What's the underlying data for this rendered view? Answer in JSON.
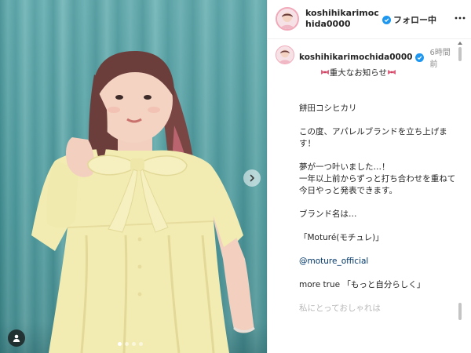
{
  "header": {
    "username": "koshihikarimochida0000",
    "follow_label": "フォロー中",
    "more_icon": "more-horizontal-icon"
  },
  "post": {
    "username": "koshihikarimochida0000",
    "time": "6時間前",
    "caption": {
      "headline": "重大なお知らせ",
      "name": "餅田コシヒカリ",
      "line1": "この度、アパレルブランドを立ち上げます！",
      "line2": "夢が一つ叶いました…！\n一年以上前からずっと打ち合わせを重ねて\n今日やっと発表できます。",
      "line3": "ブランド名は…",
      "line4": "「Moturé(モチュレ)」",
      "mention": "@moture_official",
      "line5": "more true 「もっと自分らしく」",
      "line6": "私にとっておしゃれは"
    }
  },
  "media": {
    "carousel_dots": 4,
    "active_dot": 0,
    "next_icon": "chevron-right-icon",
    "tag_icon": "user-tag-icon"
  },
  "colors": {
    "verified": "#1e97f1",
    "link": "#00376b",
    "curtain": "#4f9ca0",
    "dress": "#f3ecb2"
  }
}
